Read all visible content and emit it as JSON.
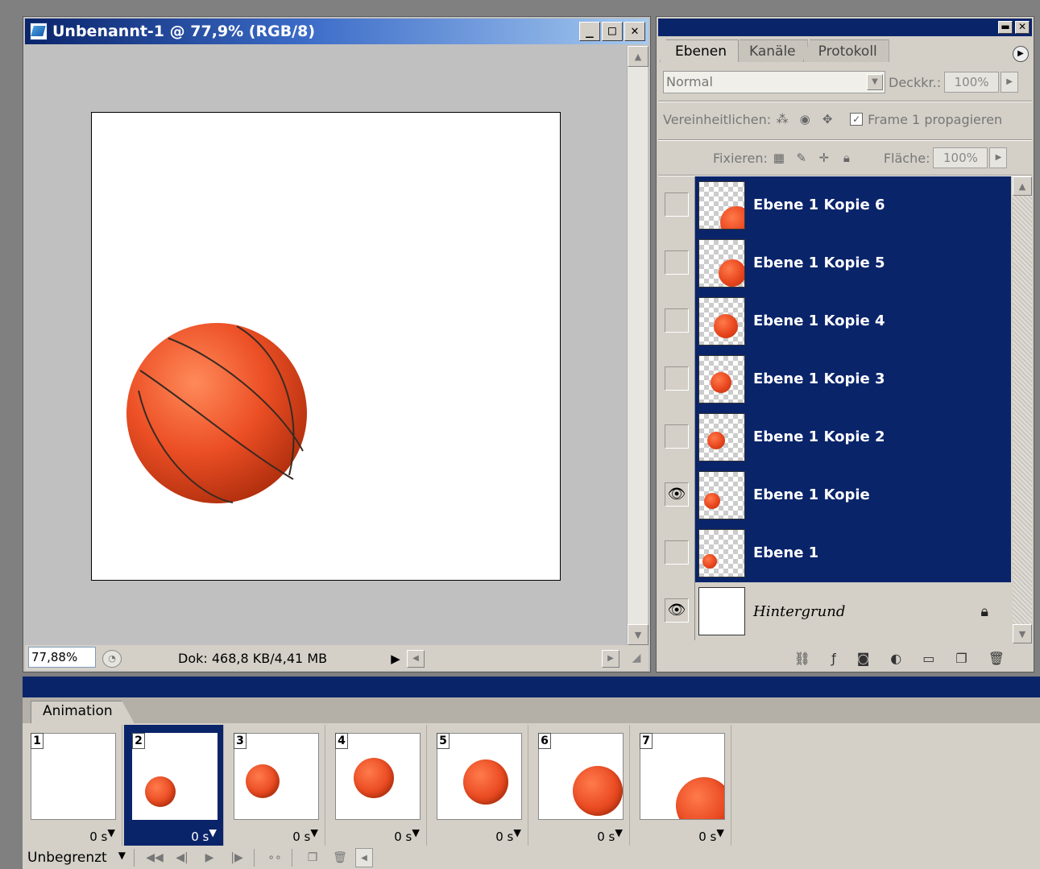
{
  "document": {
    "title": "Unbenannt-1 @ 77,9% (RGB/8)",
    "zoom": "77,88%",
    "doc_info": "Dok: 468,8 KB/4,41 MB"
  },
  "layers_panel": {
    "tabs": [
      {
        "label": "Ebenen",
        "active": true
      },
      {
        "label": "Kanäle",
        "active": false
      },
      {
        "label": "Protokoll",
        "active": false
      }
    ],
    "blend_mode": "Normal",
    "opacity_label": "Deckkr.:",
    "opacity_value": "100%",
    "unify_label": "Vereinheitlichen:",
    "propagate_label": "Frame 1 propagieren",
    "lock_label": "Fixieren:",
    "fill_label": "Fläche:",
    "fill_value": "100%",
    "layers": [
      {
        "name": "Ebene 1 Kopie 6",
        "visible": false,
        "selected": true
      },
      {
        "name": "Ebene 1 Kopie 5",
        "visible": false,
        "selected": true
      },
      {
        "name": "Ebene 1 Kopie 4",
        "visible": false,
        "selected": true
      },
      {
        "name": "Ebene 1 Kopie 3",
        "visible": false,
        "selected": true
      },
      {
        "name": "Ebene 1 Kopie 2",
        "visible": false,
        "selected": true
      },
      {
        "name": "Ebene 1 Kopie",
        "visible": true,
        "selected": true
      },
      {
        "name": "Ebene 1",
        "visible": false,
        "selected": true
      },
      {
        "name": "Hintergrund",
        "visible": true,
        "selected": false,
        "locked": true
      }
    ]
  },
  "animation_panel": {
    "tab_label": "Animation",
    "frames": [
      {
        "number": "1",
        "delay": "0 s",
        "selected": false
      },
      {
        "number": "2",
        "delay": "0 s",
        "selected": true
      },
      {
        "number": "3",
        "delay": "0 s",
        "selected": false
      },
      {
        "number": "4",
        "delay": "0 s",
        "selected": false
      },
      {
        "number": "5",
        "delay": "0 s",
        "selected": false
      },
      {
        "number": "6",
        "delay": "0 s",
        "selected": false
      },
      {
        "number": "7",
        "delay": "0 s",
        "selected": false
      }
    ],
    "loop_option": "Unbegrenzt"
  },
  "colors": {
    "selection_blue": "#0a246a",
    "panel_gray": "#d4d0c8",
    "ball_orange": "#e8461e"
  }
}
